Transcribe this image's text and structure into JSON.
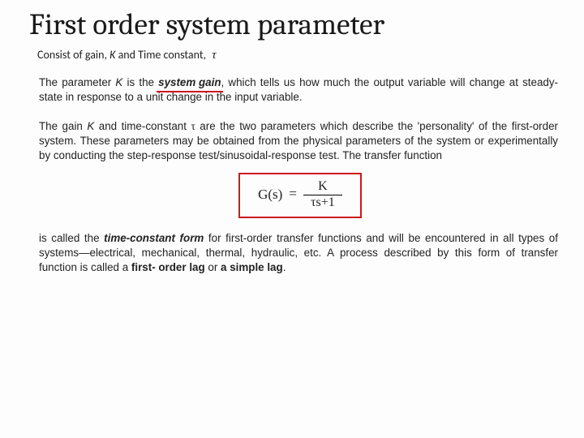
{
  "title": "First order system parameter",
  "subtitle": {
    "pre": "Consist of gain, ",
    "k": "K",
    "between": " and  Time constant,",
    "tau": "τ"
  },
  "para1": {
    "lead": "The parameter ",
    "k": "K",
    "is_the": " is the ",
    "system_gain": "system gain",
    "rest": ", which tells us how much the output variable will change at steady-state in response to a unit change in the input variable."
  },
  "para2": {
    "a": "The gain ",
    "k": "K",
    "b": " and time-constant ",
    "tau": "τ",
    "c": " are the two parameters which describe the 'personality' of the first-order system. These parameters may be obtained from the physical parameters of the system or experimentally by conducting the step-response test/sinusoidal-response test. The transfer function"
  },
  "formula": {
    "lhs": "G(s)",
    "eq": "=",
    "num": "K",
    "den_tau": "τ",
    "den_rest": "s+1"
  },
  "para3": {
    "a": "is called the ",
    "tcf": "time-constant form",
    "b": " for first-order transfer functions and will be encountered in all types of systems—electrical, mechanical, thermal, hydraulic, etc. A process described by this form of transfer function is called a ",
    "fol": "first- order lag",
    "c": " or ",
    "sl": "a simple lag",
    "d": "."
  }
}
